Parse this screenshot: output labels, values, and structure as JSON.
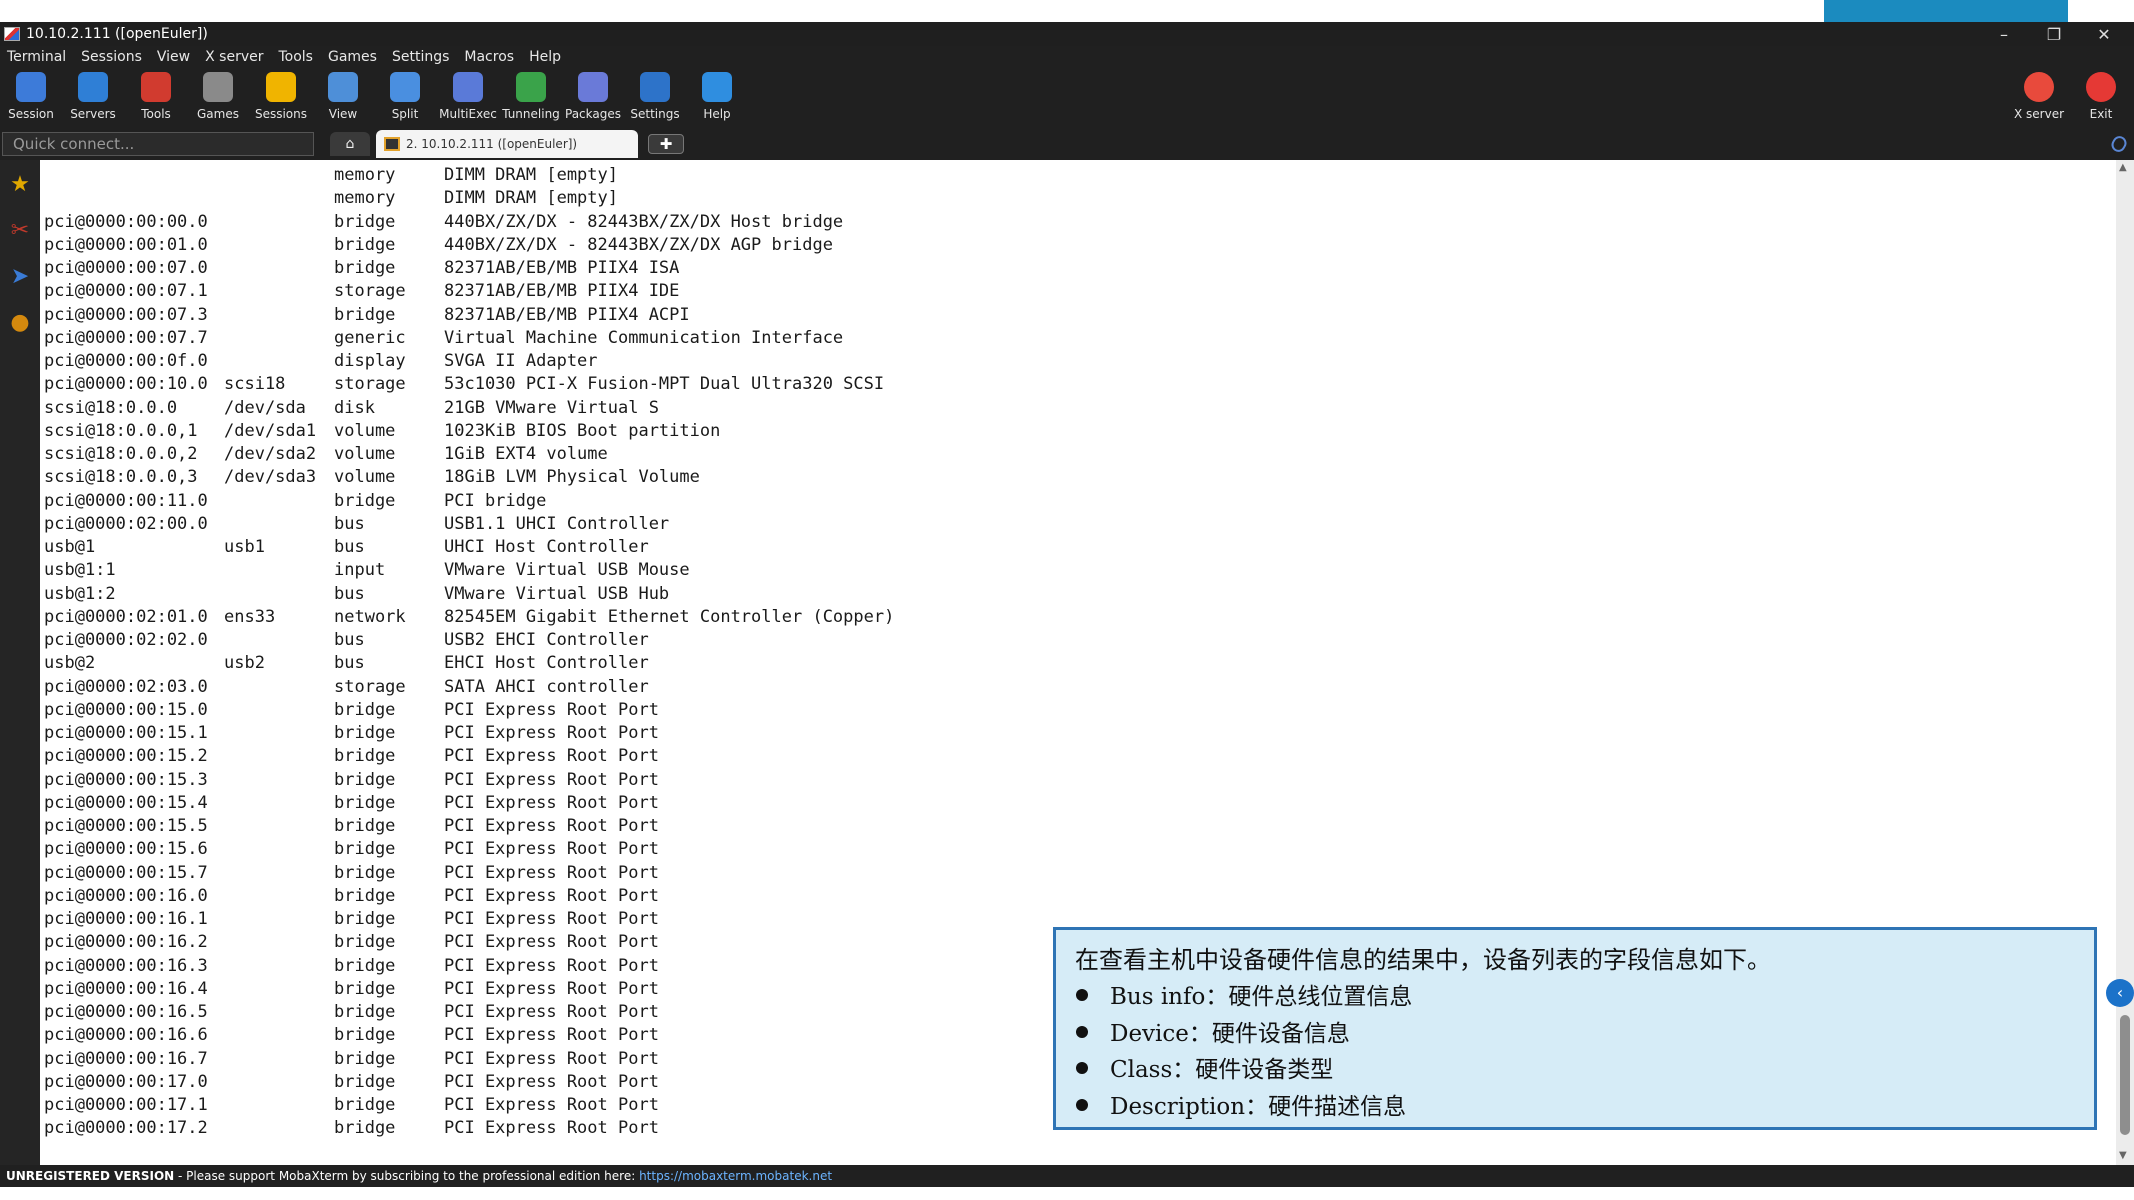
{
  "window": {
    "title": "10.10.2.111 ([openEuler])",
    "controls": {
      "minimize": "–",
      "restore": "❐",
      "close": "✕"
    }
  },
  "menu": [
    "Terminal",
    "Sessions",
    "View",
    "X server",
    "Tools",
    "Games",
    "Settings",
    "Macros",
    "Help"
  ],
  "toolbar": {
    "left": [
      {
        "label": "Session",
        "icon": "session-icon",
        "color": "#3d7bd9"
      },
      {
        "label": "Servers",
        "icon": "servers-icon",
        "color": "#2f7fd6"
      },
      {
        "label": "Tools",
        "icon": "tools-icon",
        "color": "#d13b2f"
      },
      {
        "label": "Games",
        "icon": "gamepad-icon",
        "color": "#8a8a8a"
      },
      {
        "label": "Sessions",
        "icon": "star-icon",
        "color": "#f0b400"
      },
      {
        "label": "View",
        "icon": "view-icon",
        "color": "#4e8fd8"
      },
      {
        "label": "Split",
        "icon": "split-icon",
        "color": "#4a8fe0"
      },
      {
        "label": "MultiExec",
        "icon": "multiexec-icon",
        "color": "#5a7ad8"
      },
      {
        "label": "Tunneling",
        "icon": "tunneling-icon",
        "color": "#3aa34a"
      },
      {
        "label": "Packages",
        "icon": "packages-icon",
        "color": "#6a7ad8"
      },
      {
        "label": "Settings",
        "icon": "gear-icon",
        "color": "#2d73c9"
      },
      {
        "label": "Help",
        "icon": "help-icon",
        "color": "#2f8ee0"
      }
    ],
    "right": [
      {
        "label": "X server",
        "icon": "xserver-icon",
        "color": "#e84a3c"
      },
      {
        "label": "Exit",
        "icon": "power-icon",
        "color": "#e53935"
      }
    ]
  },
  "tabs": {
    "quick_connect_placeholder": "Quick connect...",
    "home_glyph": "⌂",
    "session_tab": "2. 10.10.2.111 ([openEuler])",
    "add_glyph": "✚"
  },
  "terminal": {
    "rows": [
      {
        "path": "",
        "device": "",
        "class": "memory",
        "description": "DIMM DRAM [empty]"
      },
      {
        "path": "",
        "device": "",
        "class": "memory",
        "description": "DIMM DRAM [empty]"
      },
      {
        "path": "pci@0000:00:00.0",
        "device": "",
        "class": "bridge",
        "description": "440BX/ZX/DX - 82443BX/ZX/DX Host bridge"
      },
      {
        "path": "pci@0000:00:01.0",
        "device": "",
        "class": "bridge",
        "description": "440BX/ZX/DX - 82443BX/ZX/DX AGP bridge"
      },
      {
        "path": "pci@0000:00:07.0",
        "device": "",
        "class": "bridge",
        "description": "82371AB/EB/MB PIIX4 ISA"
      },
      {
        "path": "pci@0000:00:07.1",
        "device": "",
        "class": "storage",
        "description": "82371AB/EB/MB PIIX4 IDE"
      },
      {
        "path": "pci@0000:00:07.3",
        "device": "",
        "class": "bridge",
        "description": "82371AB/EB/MB PIIX4 ACPI"
      },
      {
        "path": "pci@0000:00:07.7",
        "device": "",
        "class": "generic",
        "description": "Virtual Machine Communication Interface"
      },
      {
        "path": "pci@0000:00:0f.0",
        "device": "",
        "class": "display",
        "description": "SVGA II Adapter"
      },
      {
        "path": "pci@0000:00:10.0",
        "device": "scsi18",
        "class": "storage",
        "description": "53c1030 PCI-X Fusion-MPT Dual Ultra320 SCSI"
      },
      {
        "path": "scsi@18:0.0.0",
        "device": "/dev/sda",
        "class": "disk",
        "description": "21GB VMware Virtual S"
      },
      {
        "path": "scsi@18:0.0.0,1",
        "device": "/dev/sda1",
        "class": "volume",
        "description": "1023KiB BIOS Boot partition"
      },
      {
        "path": "scsi@18:0.0.0,2",
        "device": "/dev/sda2",
        "class": "volume",
        "description": "1GiB EXT4 volume"
      },
      {
        "path": "scsi@18:0.0.0,3",
        "device": "/dev/sda3",
        "class": "volume",
        "description": "18GiB LVM Physical Volume"
      },
      {
        "path": "pci@0000:00:11.0",
        "device": "",
        "class": "bridge",
        "description": "PCI bridge"
      },
      {
        "path": "pci@0000:02:00.0",
        "device": "",
        "class": "bus",
        "description": "USB1.1 UHCI Controller"
      },
      {
        "path": "usb@1",
        "device": "usb1",
        "class": "bus",
        "description": "UHCI Host Controller"
      },
      {
        "path": "usb@1:1",
        "device": "",
        "class": "input",
        "description": "VMware Virtual USB Mouse"
      },
      {
        "path": "usb@1:2",
        "device": "",
        "class": "bus",
        "description": "VMware Virtual USB Hub"
      },
      {
        "path": "pci@0000:02:01.0",
        "device": "ens33",
        "class": "network",
        "description": "82545EM Gigabit Ethernet Controller (Copper)"
      },
      {
        "path": "pci@0000:02:02.0",
        "device": "",
        "class": "bus",
        "description": "USB2 EHCI Controller"
      },
      {
        "path": "usb@2",
        "device": "usb2",
        "class": "bus",
        "description": "EHCI Host Controller"
      },
      {
        "path": "pci@0000:02:03.0",
        "device": "",
        "class": "storage",
        "description": "SATA AHCI controller"
      },
      {
        "path": "pci@0000:00:15.0",
        "device": "",
        "class": "bridge",
        "description": "PCI Express Root Port"
      },
      {
        "path": "pci@0000:00:15.1",
        "device": "",
        "class": "bridge",
        "description": "PCI Express Root Port"
      },
      {
        "path": "pci@0000:00:15.2",
        "device": "",
        "class": "bridge",
        "description": "PCI Express Root Port"
      },
      {
        "path": "pci@0000:00:15.3",
        "device": "",
        "class": "bridge",
        "description": "PCI Express Root Port"
      },
      {
        "path": "pci@0000:00:15.4",
        "device": "",
        "class": "bridge",
        "description": "PCI Express Root Port"
      },
      {
        "path": "pci@0000:00:15.5",
        "device": "",
        "class": "bridge",
        "description": "PCI Express Root Port"
      },
      {
        "path": "pci@0000:00:15.6",
        "device": "",
        "class": "bridge",
        "description": "PCI Express Root Port"
      },
      {
        "path": "pci@0000:00:15.7",
        "device": "",
        "class": "bridge",
        "description": "PCI Express Root Port"
      },
      {
        "path": "pci@0000:00:16.0",
        "device": "",
        "class": "bridge",
        "description": "PCI Express Root Port"
      },
      {
        "path": "pci@0000:00:16.1",
        "device": "",
        "class": "bridge",
        "description": "PCI Express Root Port"
      },
      {
        "path": "pci@0000:00:16.2",
        "device": "",
        "class": "bridge",
        "description": "PCI Express Root Port"
      },
      {
        "path": "pci@0000:00:16.3",
        "device": "",
        "class": "bridge",
        "description": "PCI Express Root Port"
      },
      {
        "path": "pci@0000:00:16.4",
        "device": "",
        "class": "bridge",
        "description": "PCI Express Root Port"
      },
      {
        "path": "pci@0000:00:16.5",
        "device": "",
        "class": "bridge",
        "description": "PCI Express Root Port"
      },
      {
        "path": "pci@0000:00:16.6",
        "device": "",
        "class": "bridge",
        "description": "PCI Express Root Port"
      },
      {
        "path": "pci@0000:00:16.7",
        "device": "",
        "class": "bridge",
        "description": "PCI Express Root Port"
      },
      {
        "path": "pci@0000:00:17.0",
        "device": "",
        "class": "bridge",
        "description": "PCI Express Root Port"
      },
      {
        "path": "pci@0000:00:17.1",
        "device": "",
        "class": "bridge",
        "description": "PCI Express Root Port"
      },
      {
        "path": "pci@0000:00:17.2",
        "device": "",
        "class": "bridge",
        "description": "PCI Express Root Port"
      }
    ]
  },
  "note": {
    "heading": "在查看主机中设备硬件信息的结果中，设备列表的字段信息如下。",
    "items": [
      "Bus info：硬件总线位置信息",
      "Device：硬件设备信息",
      "Class：硬件设备类型",
      "Description：硬件描述信息"
    ]
  },
  "status": {
    "badge": "UNREGISTERED VERSION",
    "message": " - Please support MobaXterm by subscribing to the professional edition here: ",
    "link": "https://mobaxterm.mobatek.net"
  }
}
